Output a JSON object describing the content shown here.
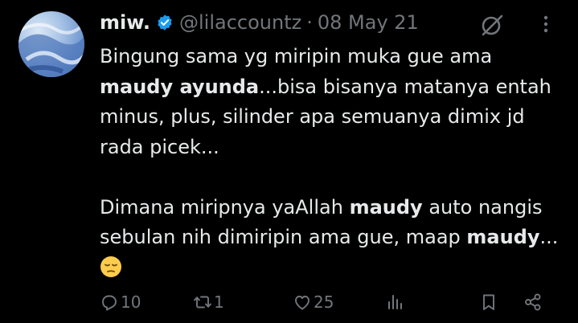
{
  "author": {
    "name": "miw.",
    "handle": "@lilaccountz",
    "separator": "·",
    "date": "08 May 21"
  },
  "tweet": {
    "line1": "Bingung sama yg miripin muka gue ama",
    "bold1": "maudy ayunda",
    "after_bold1": "...bisa bisanya matanya entah minus, plus, silinder apa semuanya dimix jd rada picek...",
    "p2_start": "Dimana miripnya yaAllah ",
    "bold2": "maudy",
    "p2_mid": " auto nangis sebulan nih dimiripin ama gue, maap ",
    "bold3": "maudy",
    "p2_end": "...",
    "emoji": "pensive-face"
  },
  "actions": {
    "replies": "10",
    "retweets": "1",
    "likes": "25"
  },
  "icons": [
    "verified-badge-icon",
    "grok-icon",
    "more-icon",
    "reply-icon",
    "retweet-icon",
    "like-icon",
    "views-icon",
    "bookmark-icon",
    "share-icon"
  ],
  "colors": {
    "background": "#000000",
    "text": "#e7e9ea",
    "muted": "#71767b",
    "verified": "#1d9bf0"
  }
}
